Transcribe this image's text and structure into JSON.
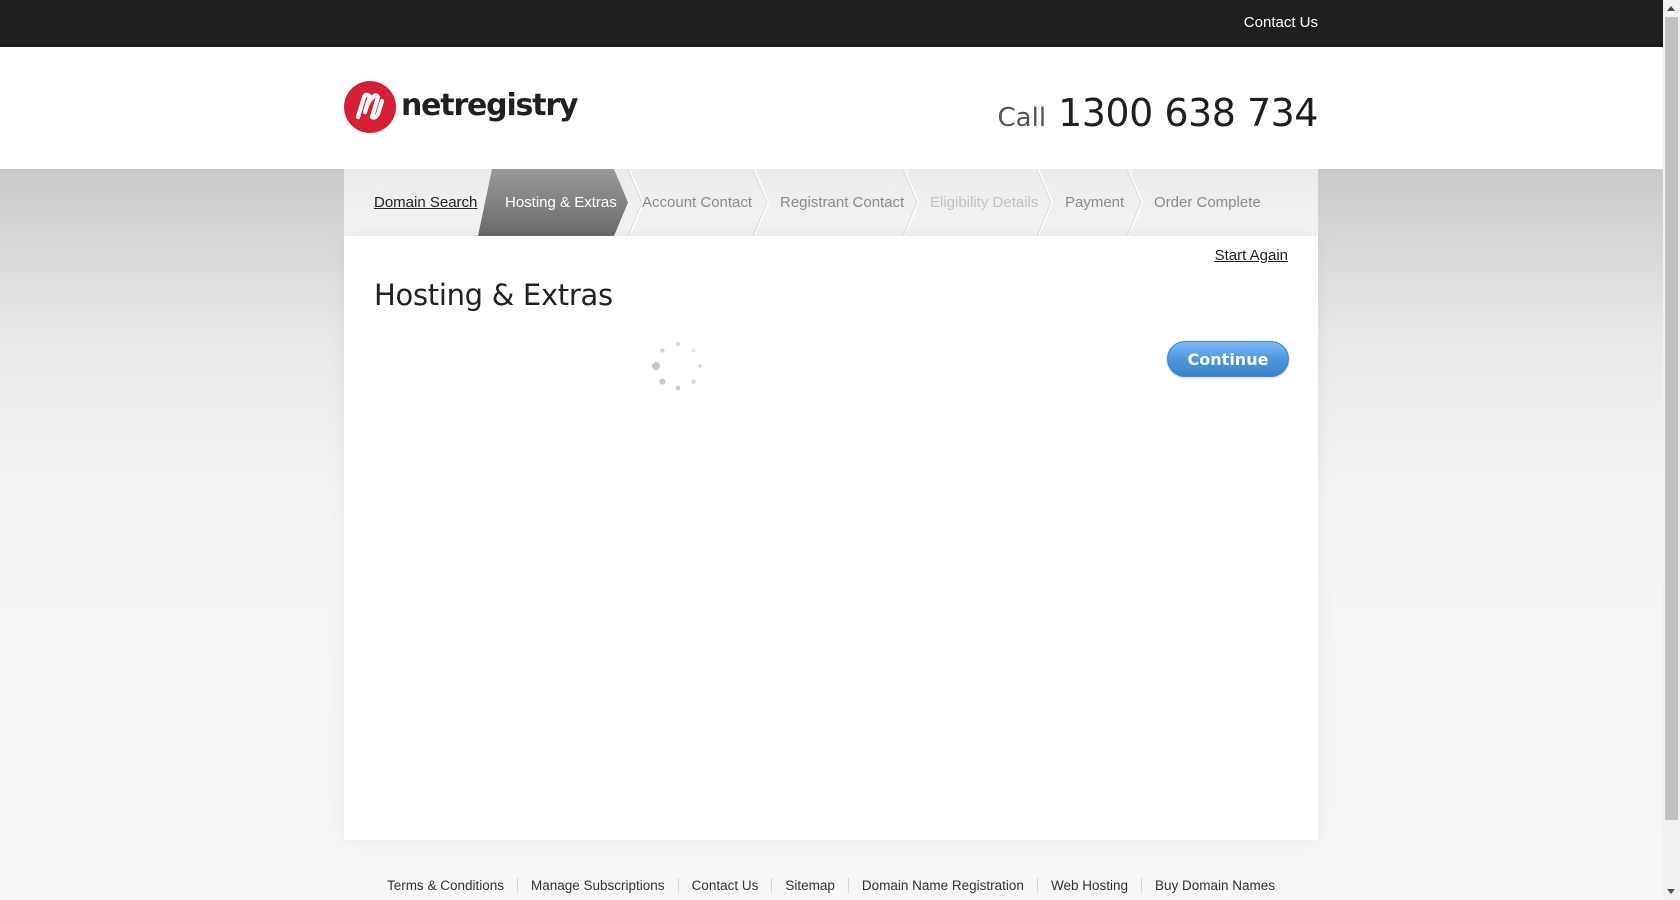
{
  "topbar": {
    "contact_label": "Contact Us"
  },
  "header": {
    "brand": "netregistry",
    "call_label": "Call",
    "phone": "1300 638 734"
  },
  "steps": [
    {
      "label": "Domain Search",
      "state": "done"
    },
    {
      "label": "Hosting & Extras",
      "state": "active"
    },
    {
      "label": "Account Contact",
      "state": "pending"
    },
    {
      "label": "Registrant Contact",
      "state": "pending"
    },
    {
      "label": "Eligibility Details",
      "state": "disabled"
    },
    {
      "label": "Payment",
      "state": "pending"
    },
    {
      "label": "Order Complete",
      "state": "pending"
    }
  ],
  "main": {
    "start_again": "Start Again",
    "title": "Hosting & Extras",
    "continue_label": "Continue",
    "loading_icon": "loading-spinner-icon"
  },
  "footer": {
    "links": [
      "Terms & Conditions",
      "Manage Subscriptions",
      "Contact Us",
      "Sitemap",
      "Domain Name Registration",
      "Web Hosting",
      "Buy Domain Names"
    ]
  },
  "colors": {
    "brand_red": "#d41f34",
    "topbar": "#1f1f1f",
    "continue_blue": "#4a94de",
    "active_step": "#7d7d7d"
  }
}
